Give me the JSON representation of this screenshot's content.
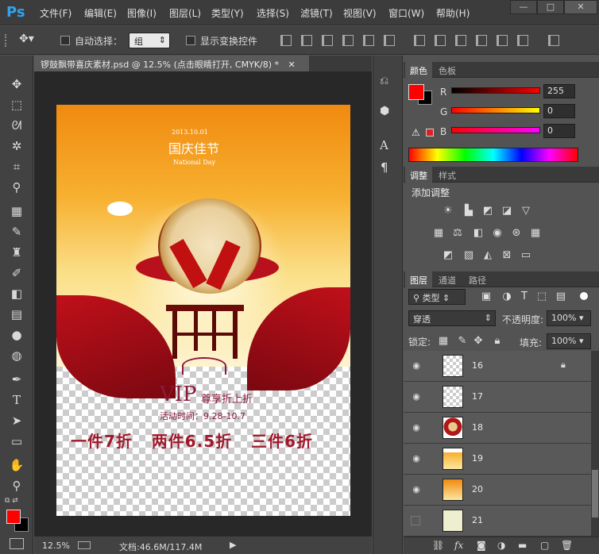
{
  "app": {
    "logo": "Ps"
  },
  "menu": [
    "文件(F)",
    "编辑(E)",
    "图像(I)",
    "图层(L)",
    "类型(Y)",
    "选择(S)",
    "滤镜(T)",
    "视图(V)",
    "窗口(W)",
    "帮助(H)"
  ],
  "window_controls": {
    "minimize": "—",
    "maximize": "□",
    "close": "✕"
  },
  "options": {
    "auto_select_label": "自动选择：",
    "auto_select_value": "组",
    "show_transform_label": "显示变换控件"
  },
  "document": {
    "tab_title": "锣鼓飘带喜庆素材.psd @ 12.5% (点击眼睛打开, CMYK/8) *",
    "tab_close": "✕",
    "zoom": "12.5%",
    "doc_size": "文档:46.6M/117.4M",
    "art": {
      "year": "2013.10.01",
      "title_cn": "国庆佳节",
      "title_en": "National Day",
      "vip_text": "VIP",
      "vip_sub": "尊享折上折",
      "date_range": "活动时间：9.28-10.7",
      "promo": "一件7折   两件6.5折   三件6折"
    }
  },
  "color_panel": {
    "tabs": [
      "颜色",
      "色板"
    ],
    "r_label": "R",
    "g_label": "G",
    "b_label": "B",
    "r": "255",
    "g": "0",
    "b": "0",
    "foreground": "#ff0000",
    "background": "#000000"
  },
  "adjust_panel": {
    "tabs": [
      "调整",
      "样式"
    ],
    "title": "添加调整"
  },
  "layers_panel": {
    "tabs": [
      "图层",
      "通道",
      "路径"
    ],
    "filter_label": "类型",
    "blend_mode": "穿透",
    "opacity_label": "不透明度:",
    "opacity": "100%",
    "lock_label": "锁定:",
    "fill_label": "填充:",
    "fill": "100%",
    "layers": [
      {
        "name": "16",
        "visible": true,
        "locked": true,
        "thumb": "empty"
      },
      {
        "name": "17",
        "visible": true,
        "locked": false,
        "thumb": "empty"
      },
      {
        "name": "18",
        "visible": true,
        "locked": false,
        "thumb": "drum"
      },
      {
        "name": "19",
        "visible": true,
        "locked": false,
        "thumb": "sky"
      },
      {
        "name": "20",
        "visible": true,
        "locked": false,
        "thumb": "sky2"
      },
      {
        "name": "21",
        "visible": false,
        "locked": false,
        "thumb": "cream"
      }
    ],
    "footer_icons": [
      "link-icon",
      "fx-icon",
      "mask-icon",
      "adjustment-icon",
      "folder-icon",
      "new-layer-icon",
      "trash-icon"
    ]
  }
}
